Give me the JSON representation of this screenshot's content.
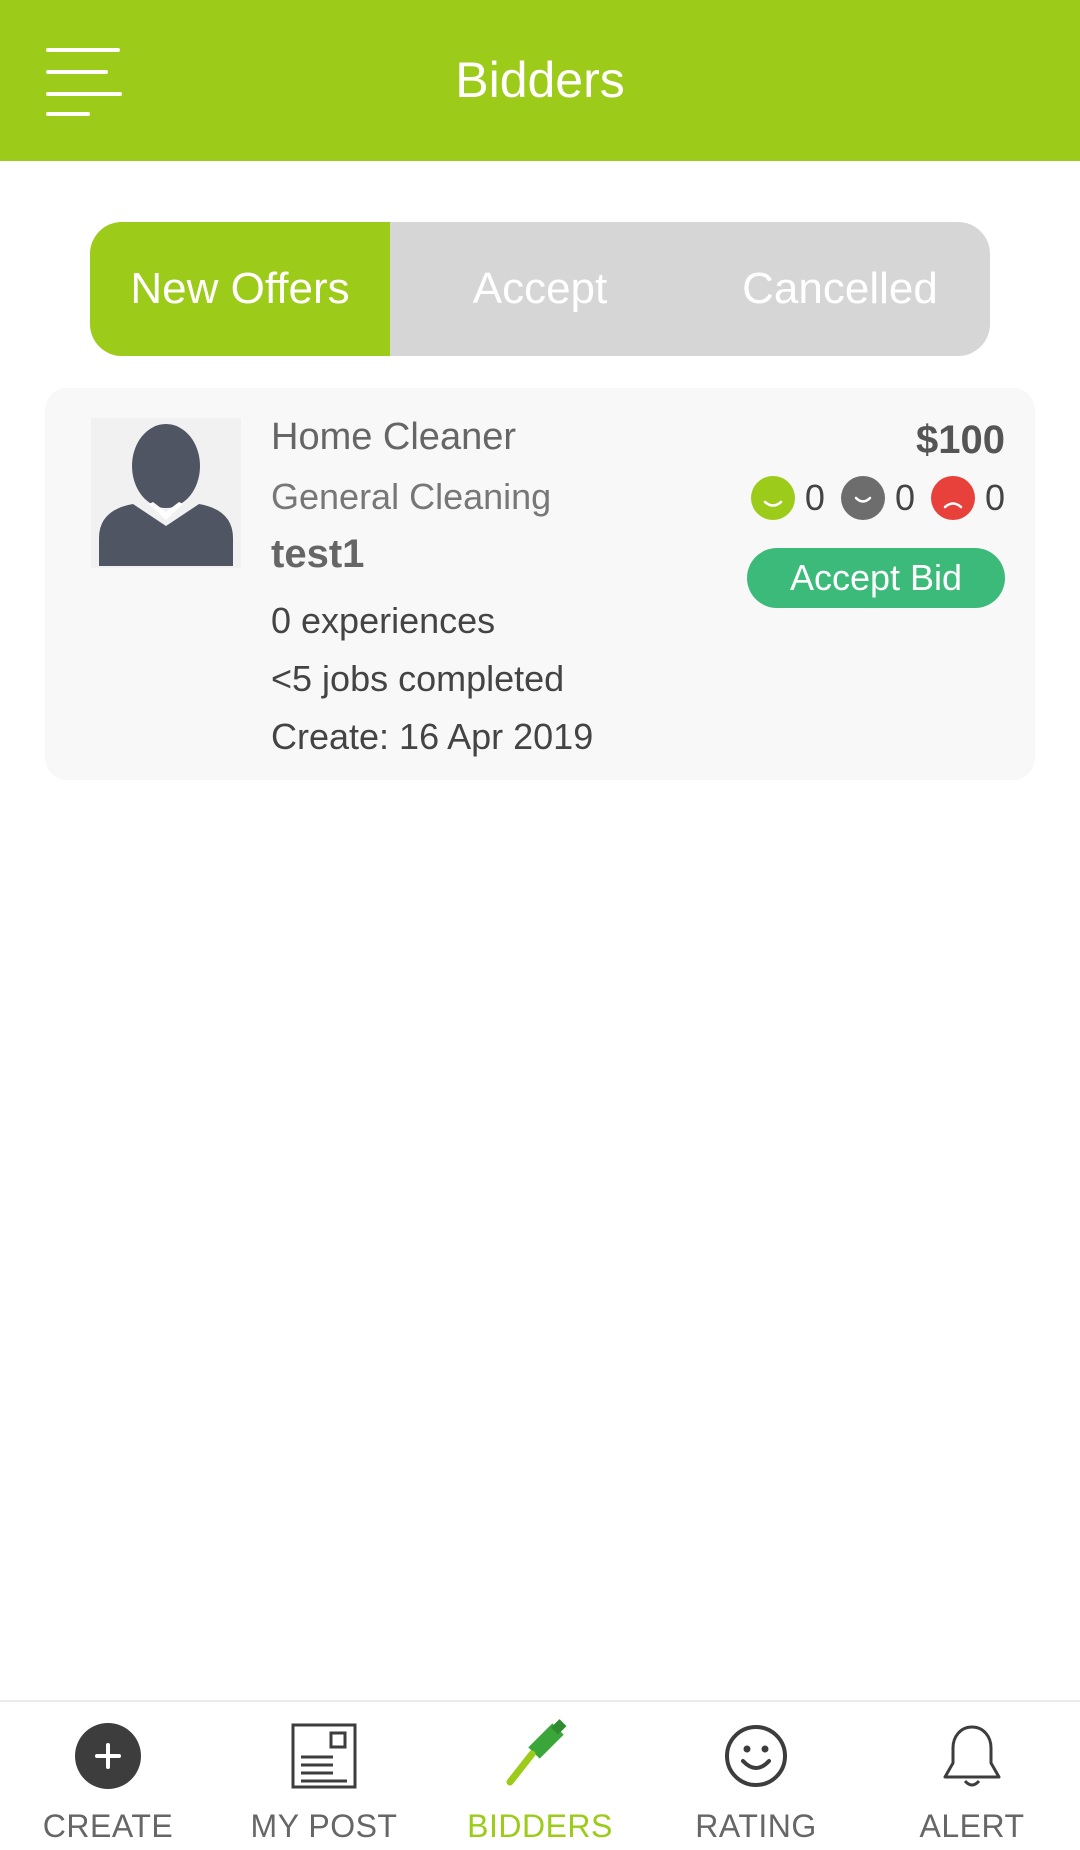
{
  "header": {
    "title": "Bidders",
    "menu_icon": "menu-icon"
  },
  "tabs": [
    {
      "label": "New Offers",
      "active": true
    },
    {
      "label": "Accept",
      "active": false
    },
    {
      "label": "Cancelled",
      "active": false
    }
  ],
  "bid": {
    "service": "Home Cleaner",
    "category": "General Cleaning",
    "bidder_name": "test1",
    "experiences": "0 experiences",
    "jobs_completed": "<5 jobs completed",
    "created": "Create: 16 Apr 2019",
    "price": "$100",
    "ratings": {
      "positive": "0",
      "neutral": "0",
      "negative": "0"
    },
    "accept_label": "Accept Bid"
  },
  "bottom_nav": [
    {
      "label": "CREATE",
      "icon": "plus-circle-icon",
      "active": false
    },
    {
      "label": "MY POST",
      "icon": "post-icon",
      "active": false
    },
    {
      "label": "BIDDERS",
      "icon": "gavel-icon",
      "active": true
    },
    {
      "label": "RATING",
      "icon": "smiley-icon",
      "active": false
    },
    {
      "label": "ALERT",
      "icon": "bell-icon",
      "active": false
    }
  ],
  "colors": {
    "brand": "#9ccb19",
    "accept": "#3bba79",
    "tab_inactive": "#d6d6d6",
    "rating_positive": "#9ccb19",
    "rating_neutral": "#6d6d6d",
    "rating_negative": "#e8403a"
  }
}
